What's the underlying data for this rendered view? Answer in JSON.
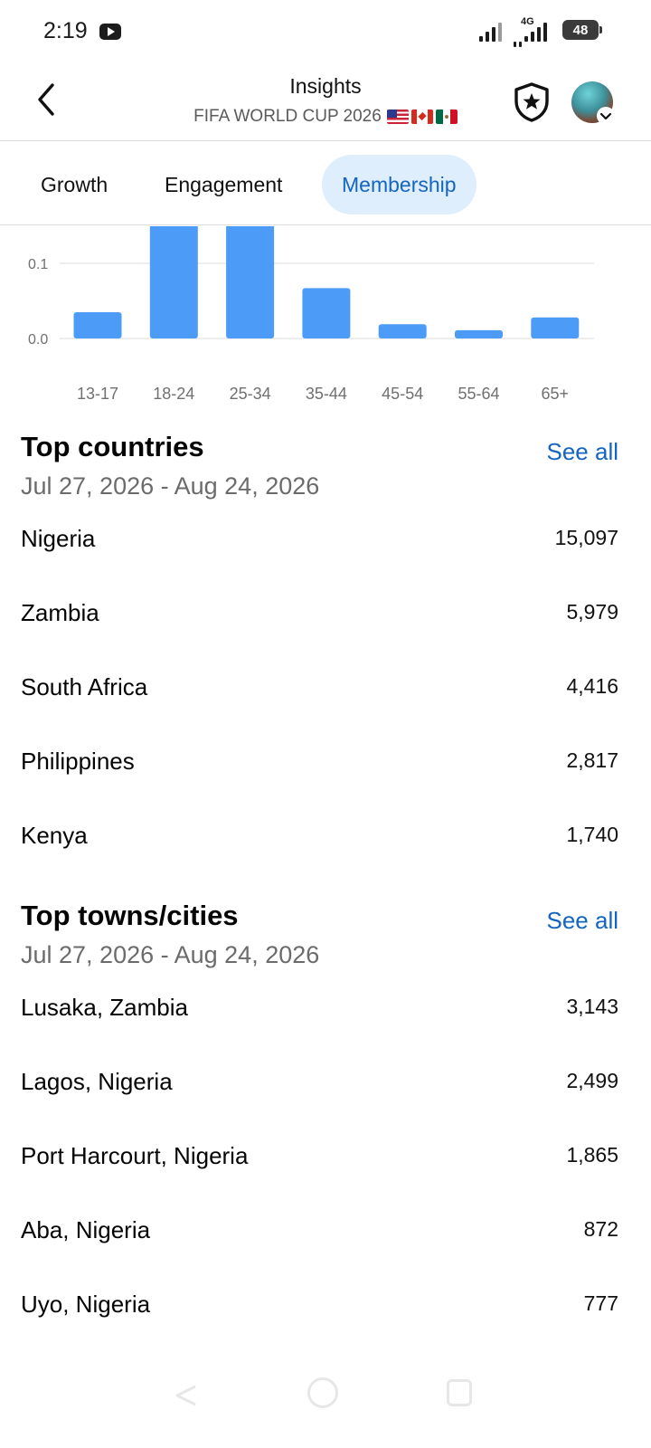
{
  "status_bar": {
    "time": "2:19",
    "network": "4G",
    "battery": "48"
  },
  "header": {
    "title": "Insights",
    "subtitle": "FIFA WORLD CUP 2026"
  },
  "tabs": [
    {
      "label": "Growth",
      "active": false
    },
    {
      "label": "Engagement",
      "active": false
    },
    {
      "label": "Membership",
      "active": true
    }
  ],
  "chart_data": {
    "type": "bar",
    "categories": [
      "13-17",
      "18-24",
      "25-34",
      "35-44",
      "45-54",
      "55-64",
      "65+"
    ],
    "values": [
      0.035,
      0.16,
      0.16,
      0.067,
      0.019,
      0.011,
      0.028
    ],
    "ytick_labels": [
      "0.0",
      "0.1"
    ],
    "visible_ylim": [
      0,
      0.15
    ],
    "color": "#4c9cf7",
    "grid": true
  },
  "top_countries": {
    "title": "Top countries",
    "see_all": "See all",
    "date_range": "Jul 27, 2026 - Aug 24, 2026",
    "items": [
      {
        "name": "Nigeria",
        "value": "15,097"
      },
      {
        "name": "Zambia",
        "value": "5,979"
      },
      {
        "name": "South Africa",
        "value": "4,416"
      },
      {
        "name": "Philippines",
        "value": "2,817"
      },
      {
        "name": "Kenya",
        "value": "1,740"
      }
    ]
  },
  "top_cities": {
    "title": "Top towns/cities",
    "see_all": "See all",
    "date_range": "Jul 27, 2026 - Aug 24, 2026",
    "items": [
      {
        "name": "Lusaka, Zambia",
        "value": "3,143"
      },
      {
        "name": "Lagos, Nigeria",
        "value": "2,499"
      },
      {
        "name": "Port Harcourt, Nigeria",
        "value": "1,865"
      },
      {
        "name": "Aba, Nigeria",
        "value": "872"
      },
      {
        "name": "Uyo, Nigeria",
        "value": "777"
      }
    ]
  },
  "colors": {
    "accent": "#1565c0",
    "tab_active_bg": "#deeefd",
    "bar": "#4c9cf7"
  }
}
